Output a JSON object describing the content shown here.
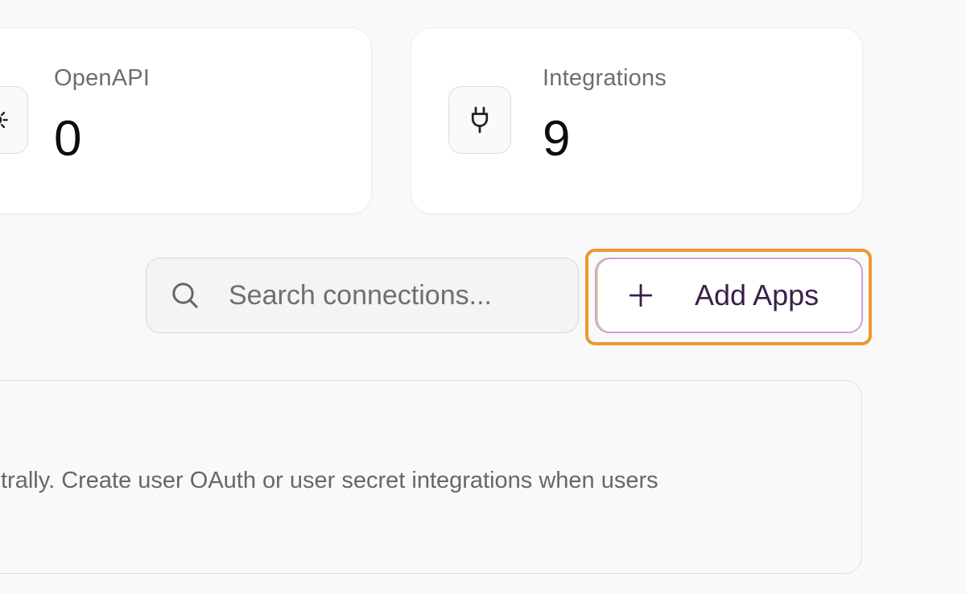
{
  "stats": {
    "openapi": {
      "label": "OpenAPI",
      "value": "0",
      "icon": "gear-icon"
    },
    "integrations": {
      "label": "Integrations",
      "value": "9",
      "icon": "plug-icon"
    }
  },
  "search": {
    "placeholder": "Search connections...",
    "value": "",
    "icon": "search-icon"
  },
  "add_button": {
    "label": "Add Apps",
    "icon": "plus-icon"
  },
  "info_panel": {
    "text": "trally. Create user OAuth or user secret integrations when users"
  },
  "colors": {
    "highlight": "#f0962e",
    "button_border": "#c9a0d8",
    "button_text": "#3a1f4a"
  }
}
